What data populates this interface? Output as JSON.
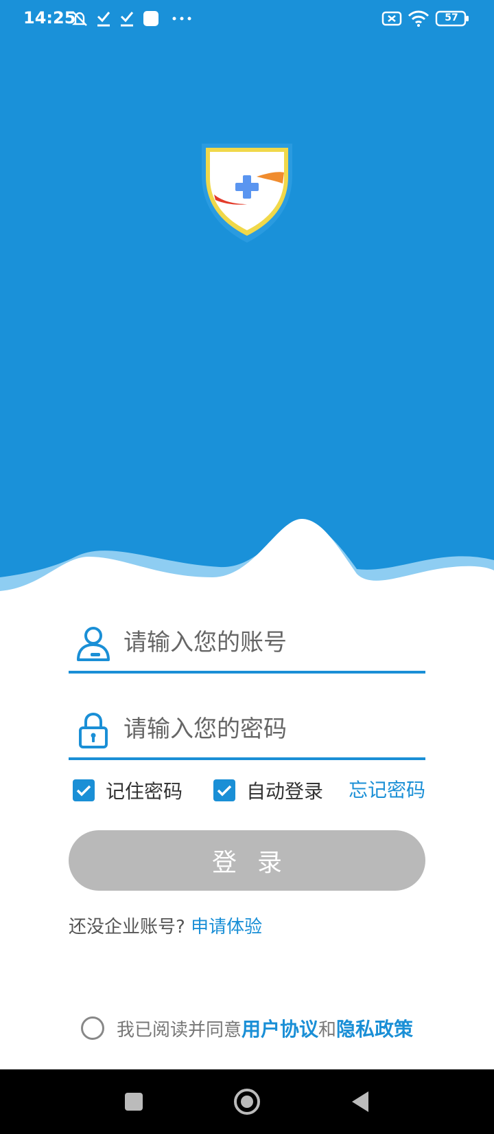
{
  "status": {
    "time": "14:25",
    "battery": "57",
    "icons": [
      "mute-icon",
      "check-icon",
      "check-icon",
      "square-icon",
      "more-icon",
      "x-box-icon",
      "wifi-icon",
      "battery-icon"
    ]
  },
  "colors": {
    "primary": "#1a91d9",
    "accent": "#1a8fd6",
    "button_disabled": "#b9b9b9"
  },
  "form": {
    "account_placeholder": "请输入您的账号",
    "password_placeholder": "请输入您的密码",
    "remember_label": "记住密码",
    "remember_checked": true,
    "auto_login_label": "自动登录",
    "auto_login_checked": true,
    "forgot_label": "忘记密码",
    "login_label": "登录"
  },
  "signup": {
    "prompt": "还没企业账号?",
    "link": "申请体验"
  },
  "agreement": {
    "checked": false,
    "prefix": "我已阅读并同意",
    "user_agreement": "用户协议",
    "and": "和",
    "privacy_policy": "隐私政策"
  }
}
